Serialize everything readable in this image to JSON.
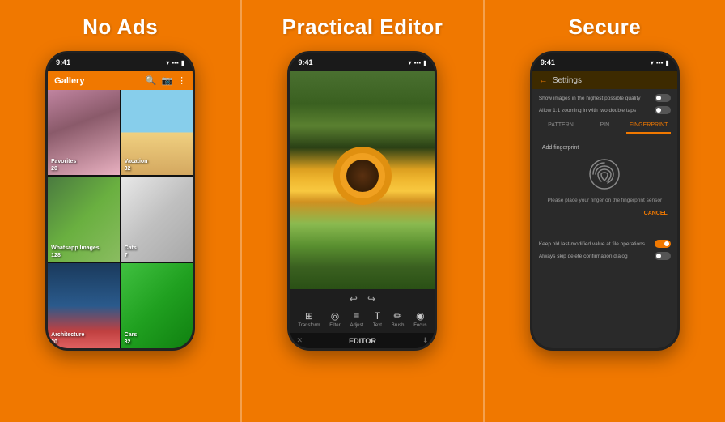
{
  "panels": [
    {
      "id": "no-ads",
      "title": "No Ads",
      "phone": {
        "time": "9:41",
        "app": "Gallery",
        "grid": [
          {
            "name": "Favorites",
            "count": "20",
            "img": "person"
          },
          {
            "name": "Vacation",
            "count": "32",
            "img": "beach"
          },
          {
            "name": "Whatsapp Images",
            "count": "128",
            "img": "plants"
          },
          {
            "name": "Cats",
            "count": "7",
            "img": "cat"
          },
          {
            "name": "Architecture",
            "count": "20",
            "img": "arch"
          },
          {
            "name": "Cars",
            "count": "32",
            "img": "car"
          }
        ]
      }
    },
    {
      "id": "practical-editor",
      "title": "Practical Editor",
      "phone": {
        "time": "9:41",
        "tools": [
          "Transform",
          "Filter",
          "Adjust",
          "Text",
          "Brush",
          "Focus"
        ],
        "editor_label": "EDITOR"
      }
    },
    {
      "id": "secure",
      "title": "Secure",
      "phone": {
        "time": "9:41",
        "settings_title": "Settings",
        "rows": [
          "Show images in the highest possible quality",
          "Allow 1:1 zooming in with two double taps"
        ],
        "tabs": [
          "PATTERN",
          "PIN",
          "FINGERPRINT"
        ],
        "active_tab": 2,
        "add_fingerprint": "Add fingerprint",
        "fp_desc": "Please place your finger on the fingerprint sensor",
        "cancel": "CANCEL",
        "bottom_rows": [
          "Keep old last-modified value at file operations",
          "Always skip delete confirmation dialog"
        ]
      }
    }
  ]
}
